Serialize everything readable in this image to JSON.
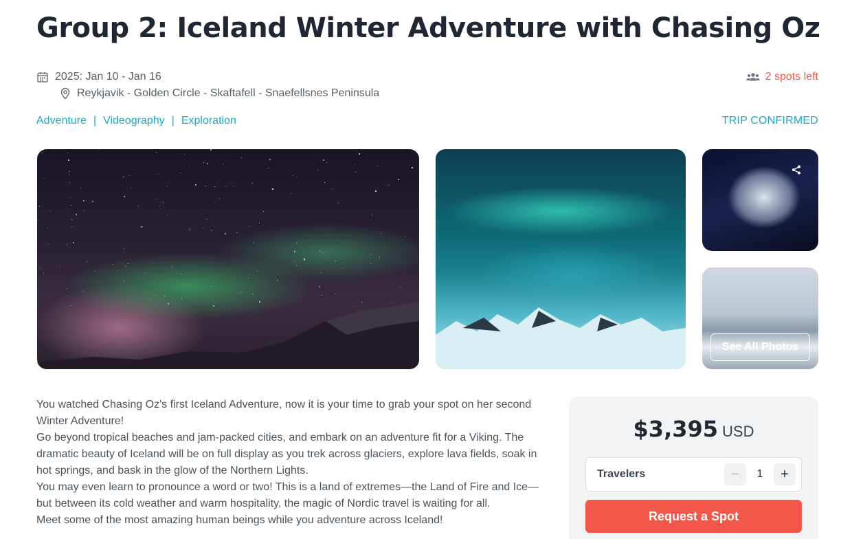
{
  "trip": {
    "title": "Group 2: Iceland Winter Adventure with Chasing Oz",
    "dates": "2025: Jan 10 - Jan 16",
    "location": "Reykjavik - Golden Circle - Skaftafell - Snaefellsnes Peninsula",
    "spots_left": "2 spots left",
    "status": "TRIP CONFIRMED"
  },
  "tags": [
    {
      "label": "Adventure"
    },
    {
      "label": "Videography"
    },
    {
      "label": "Exploration"
    }
  ],
  "tag_separator": "|",
  "gallery": {
    "see_all_label": "See All Photos"
  },
  "description": [
    "You watched Chasing Oz's first Iceland Adventure, now it is your time to grab your spot on her second Winter Adventure!",
    "Go beyond tropical beaches and jam-packed cities, and embark on an adventure fit for a Viking. The dramatic beauty of Iceland will be on full display as you trek across glaciers, explore lava fields, soak in hot springs, and bask in the glow of the Northern Lights.",
    "You may even learn to pronounce a word or two! This is a land of extremes—the Land of Fire and Ice—but between its cold weather and warm hospitality, the magic of Nordic travel is waiting for all.",
    "Meet some of the most amazing human beings while you adventure across Iceland!"
  ],
  "booking": {
    "price": "$3,395",
    "currency": "USD",
    "travelers_label": "Travelers",
    "travelers_count": "1",
    "minus_symbol": "−",
    "plus_symbol": "+",
    "request_label": "Request a Spot"
  },
  "colors": {
    "accent": "#1fa8c4",
    "cta": "#f2574a",
    "title": "#1f2733"
  },
  "icons": {
    "dates": "calendar-icon",
    "location": "map-pin-icon",
    "spots": "people-icon",
    "share": "share-icon"
  }
}
